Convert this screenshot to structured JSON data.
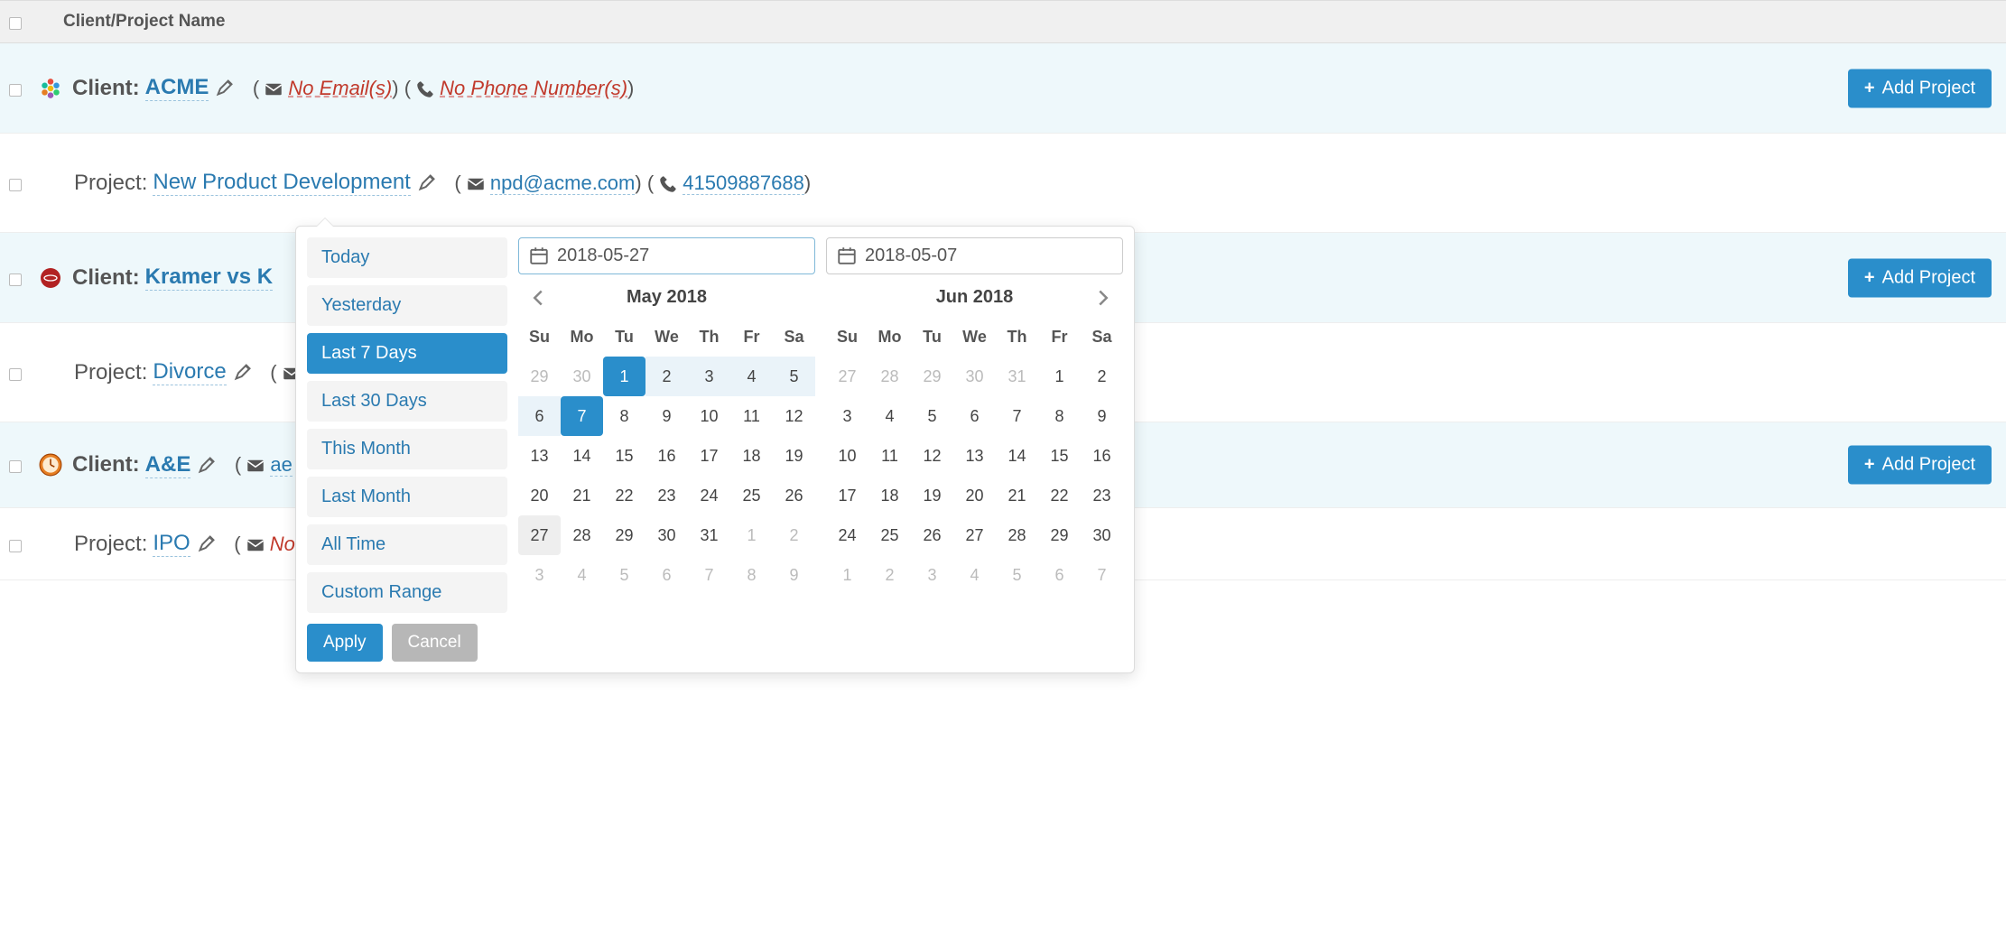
{
  "header": {
    "col_name": "Client/Project Name"
  },
  "labels": {
    "client_prefix": "Client:",
    "project_prefix": "Project:",
    "add_project": "Add Project",
    "no_emails": "No Email(s)",
    "no_phones": "No Phone Number(s)"
  },
  "clients": [
    {
      "icon": "flower",
      "name": "ACME",
      "email": null,
      "phone": null,
      "projects": [
        {
          "name": "New Product Development",
          "email": "npd@acme.com",
          "phone": "41509887688"
        }
      ]
    },
    {
      "icon": "red-badge",
      "name": "Kramer vs K",
      "email": null,
      "phone": null,
      "projects": [
        {
          "name": "Divorce",
          "email_cut": true,
          "phone": null
        }
      ]
    },
    {
      "icon": "clock",
      "name": "A&E",
      "email_prefix": "ae",
      "phone": null,
      "projects": [
        {
          "name": "IPO",
          "email": null,
          "no_email_cut": true
        }
      ]
    }
  ],
  "date_picker": {
    "ranges": [
      "Today",
      "Yesterday",
      "Last 7 Days",
      "Last 30 Days",
      "This Month",
      "Last Month",
      "All Time",
      "Custom Range"
    ],
    "active_range_index": 2,
    "start_input": "2018-05-27",
    "end_input": "2018-05-07",
    "apply_label": "Apply",
    "cancel_label": "Cancel",
    "dow": [
      "Su",
      "Mo",
      "Tu",
      "We",
      "Th",
      "Fr",
      "Sa"
    ],
    "left": {
      "title": "May 2018",
      "weeks": [
        [
          {
            "d": 29,
            "off": true
          },
          {
            "d": 30,
            "off": true
          },
          {
            "d": 1,
            "sel": "start"
          },
          {
            "d": 2,
            "range": true
          },
          {
            "d": 3,
            "range": true
          },
          {
            "d": 4,
            "range": true
          },
          {
            "d": 5,
            "range": true
          }
        ],
        [
          {
            "d": 6,
            "range": true
          },
          {
            "d": 7,
            "sel": "end"
          },
          {
            "d": 8
          },
          {
            "d": 9
          },
          {
            "d": 10
          },
          {
            "d": 11
          },
          {
            "d": 12
          }
        ],
        [
          {
            "d": 13
          },
          {
            "d": 14
          },
          {
            "d": 15
          },
          {
            "d": 16
          },
          {
            "d": 17
          },
          {
            "d": 18
          },
          {
            "d": 19
          }
        ],
        [
          {
            "d": 20
          },
          {
            "d": 21
          },
          {
            "d": 22
          },
          {
            "d": 23
          },
          {
            "d": 24
          },
          {
            "d": 25
          },
          {
            "d": 26
          }
        ],
        [
          {
            "d": 27,
            "today": true
          },
          {
            "d": 28
          },
          {
            "d": 29
          },
          {
            "d": 30
          },
          {
            "d": 31
          },
          {
            "d": 1,
            "off": true
          },
          {
            "d": 2,
            "off": true
          }
        ],
        [
          {
            "d": 3,
            "off": true
          },
          {
            "d": 4,
            "off": true
          },
          {
            "d": 5,
            "off": true
          },
          {
            "d": 6,
            "off": true
          },
          {
            "d": 7,
            "off": true
          },
          {
            "d": 8,
            "off": true
          },
          {
            "d": 9,
            "off": true
          }
        ]
      ]
    },
    "right": {
      "title": "Jun 2018",
      "weeks": [
        [
          {
            "d": 27,
            "off": true
          },
          {
            "d": 28,
            "off": true
          },
          {
            "d": 29,
            "off": true
          },
          {
            "d": 30,
            "off": true
          },
          {
            "d": 31,
            "off": true
          },
          {
            "d": 1
          },
          {
            "d": 2
          }
        ],
        [
          {
            "d": 3
          },
          {
            "d": 4
          },
          {
            "d": 5
          },
          {
            "d": 6
          },
          {
            "d": 7
          },
          {
            "d": 8
          },
          {
            "d": 9
          }
        ],
        [
          {
            "d": 10
          },
          {
            "d": 11
          },
          {
            "d": 12
          },
          {
            "d": 13
          },
          {
            "d": 14
          },
          {
            "d": 15
          },
          {
            "d": 16
          }
        ],
        [
          {
            "d": 17
          },
          {
            "d": 18
          },
          {
            "d": 19
          },
          {
            "d": 20
          },
          {
            "d": 21
          },
          {
            "d": 22
          },
          {
            "d": 23
          }
        ],
        [
          {
            "d": 24
          },
          {
            "d": 25
          },
          {
            "d": 26
          },
          {
            "d": 27
          },
          {
            "d": 28
          },
          {
            "d": 29
          },
          {
            "d": 30
          }
        ],
        [
          {
            "d": 1,
            "off": true
          },
          {
            "d": 2,
            "off": true
          },
          {
            "d": 3,
            "off": true
          },
          {
            "d": 4,
            "off": true
          },
          {
            "d": 5,
            "off": true
          },
          {
            "d": 6,
            "off": true
          },
          {
            "d": 7,
            "off": true
          }
        ]
      ]
    }
  }
}
